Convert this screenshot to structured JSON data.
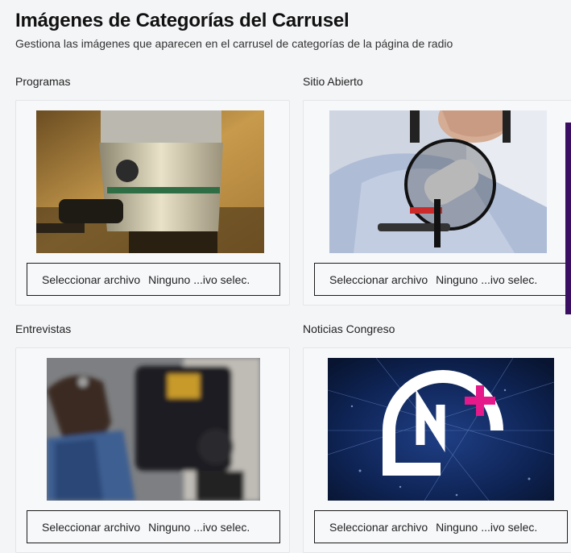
{
  "header": {
    "title": "Imágenes de Categorías del Carrusel",
    "subtitle": "Gestiona las imágenes que aparecen en el carrusel de categorías de la página de radio"
  },
  "categories": [
    {
      "label": "Programas",
      "image": "microphone-closeup",
      "button_label": "Seleccionar archivo",
      "file_status": "Ninguno ...ivo selec."
    },
    {
      "label": "Sitio Abierto",
      "image": "man-speaking-microphone",
      "button_label": "Seleccionar archivo",
      "file_status": "Ninguno ...ivo selec."
    },
    {
      "label": "Entrevistas",
      "image": "camera-operator-blurred",
      "button_label": "Seleccionar archivo",
      "file_status": "Ninguno ...ivo selec."
    },
    {
      "label": "Noticias Congreso",
      "image": "cn-plus-logo-globe",
      "button_label": "Seleccionar archivo",
      "file_status": "Ninguno ...ivo selec."
    }
  ],
  "colors": {
    "accent_sidebar": "#3a0f63",
    "logo_plus": "#e6198a"
  }
}
